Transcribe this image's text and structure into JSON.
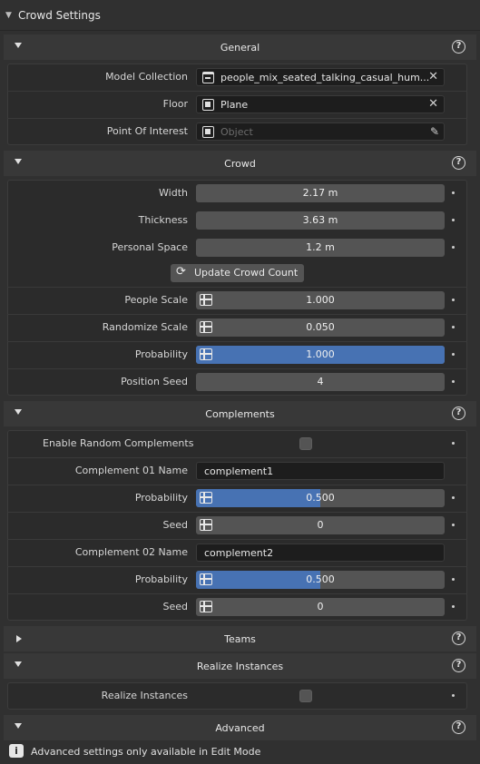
{
  "panel": {
    "title": "Crowd Settings"
  },
  "general": {
    "title": "General",
    "model_collection": {
      "label": "Model Collection",
      "value": "people_mix_seated_talking_casual_hum..."
    },
    "floor": {
      "label": "Floor",
      "value": "Plane"
    },
    "poi": {
      "label": "Point Of Interest",
      "placeholder": "Object"
    }
  },
  "crowd": {
    "title": "Crowd",
    "width": {
      "label": "Width",
      "value": "2.17 m"
    },
    "thickness": {
      "label": "Thickness",
      "value": "3.63 m"
    },
    "personal_space": {
      "label": "Personal Space",
      "value": "1.2 m"
    },
    "update_button": "Update Crowd Count",
    "people_scale": {
      "label": "People Scale",
      "value": "1.000"
    },
    "randomize_scale": {
      "label": "Randomize Scale",
      "value": "0.050"
    },
    "probability": {
      "label": "Probability",
      "value": "1.000",
      "fraction": 1.0
    },
    "position_seed": {
      "label": "Position Seed",
      "value": "4"
    }
  },
  "complements": {
    "title": "Complements",
    "enable_random": {
      "label": "Enable Random Complements",
      "checked": false
    },
    "c1_name": {
      "label": "Complement 01 Name",
      "value": "complement1"
    },
    "c1_probability": {
      "label": "Probability",
      "value": "0.500",
      "fraction": 0.5
    },
    "c1_seed": {
      "label": "Seed",
      "value": "0"
    },
    "c2_name": {
      "label": "Complement 02 Name",
      "value": "complement2"
    },
    "c2_probability": {
      "label": "Probability",
      "value": "0.500",
      "fraction": 0.5
    },
    "c2_seed": {
      "label": "Seed",
      "value": "0"
    }
  },
  "teams": {
    "title": "Teams"
  },
  "realize": {
    "title": "Realize Instances",
    "realize": {
      "label": "Realize Instances",
      "checked": false
    }
  },
  "advanced": {
    "title": "Advanced",
    "info": "Advanced settings only available in Edit Mode"
  },
  "colors": {
    "accent": "#4772b3",
    "slider": "#545454",
    "background": "#303030"
  },
  "icons": [
    "collection-icon",
    "object-icon",
    "eyedropper-icon",
    "refresh-icon",
    "info-icon",
    "help-icon",
    "decorator-dot"
  ]
}
